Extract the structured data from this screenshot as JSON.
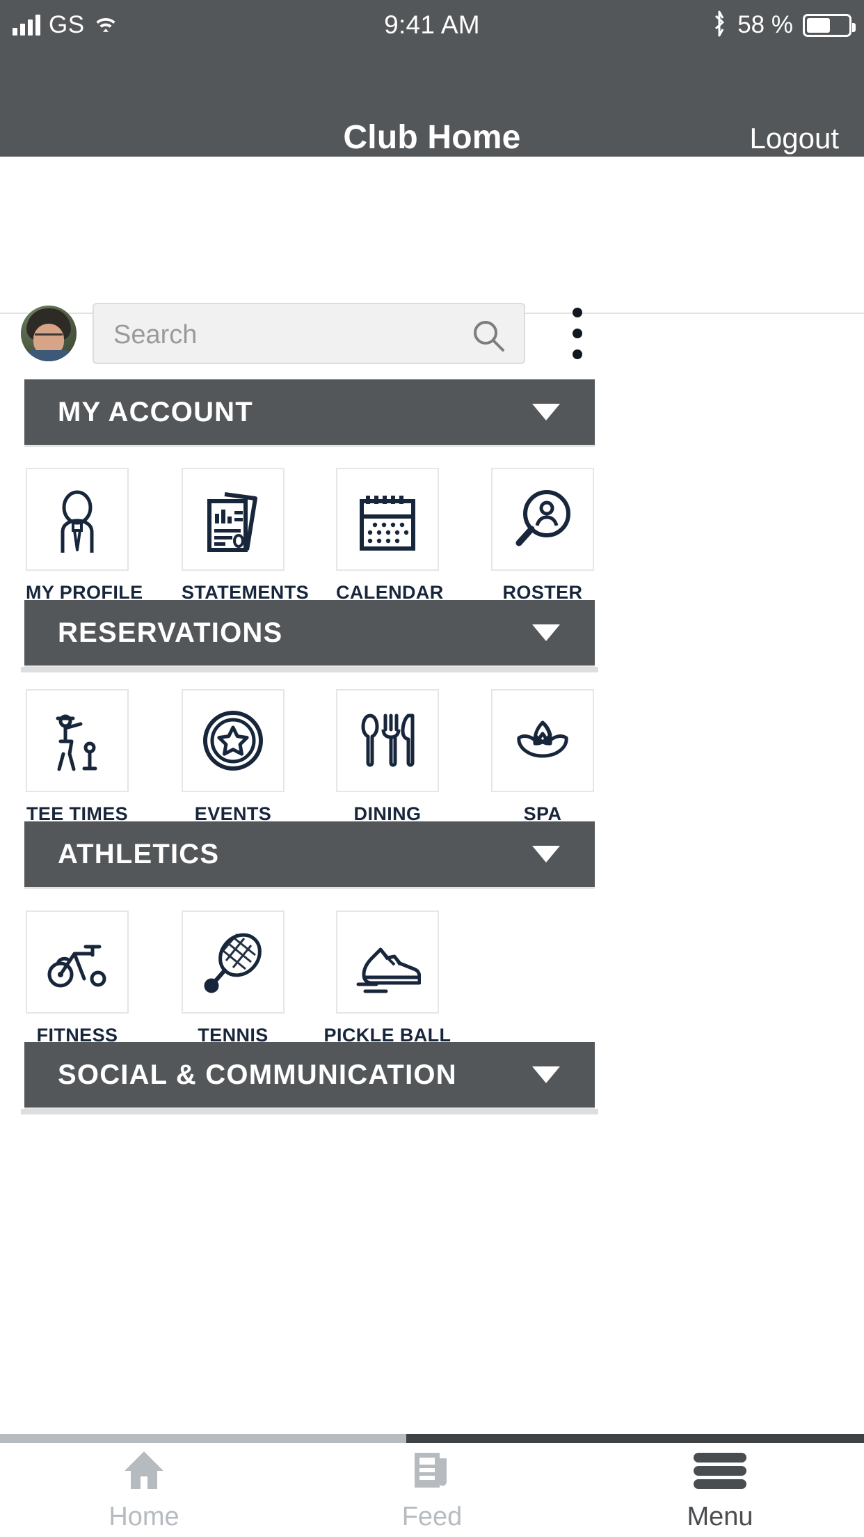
{
  "status_bar": {
    "carrier": "GS",
    "time": "9:41 AM",
    "battery_percent": "58 %",
    "signal_icon": "cellular-signal-icon",
    "wifi_icon": "wifi-icon",
    "bluetooth_icon": "bluetooth-icon",
    "battery_icon": "battery-icon",
    "battery_level": 58
  },
  "nav_bar": {
    "title": "Club Home",
    "logout_label": "Logout",
    "background_color": "#545759"
  },
  "search": {
    "placeholder": "Search",
    "value": "",
    "search_icon": "search-icon",
    "avatar": "user-avatar",
    "overflow_icon": "kebab-menu-icon"
  },
  "sections": [
    {
      "title": "MY ACCOUNT",
      "caret": "chevron-down-icon",
      "tiles": [
        {
          "label": "MY PROFILE",
          "icon": "person-tie-icon"
        },
        {
          "label": "STATEMENTS",
          "icon": "documents-report-icon"
        },
        {
          "label": "CALENDAR",
          "icon": "calendar-icon"
        },
        {
          "label": "ROSTER",
          "icon": "person-search-icon"
        }
      ]
    },
    {
      "title": "RESERVATIONS",
      "caret": "chevron-down-icon",
      "tiles": [
        {
          "label": "TEE TIMES",
          "icon": "golfer-icon"
        },
        {
          "label": "EVENTS",
          "icon": "star-badge-icon"
        },
        {
          "label": "DINING",
          "icon": "cutlery-icon"
        },
        {
          "label": "SPA",
          "icon": "lotus-icon"
        }
      ]
    },
    {
      "title": "ATHLETICS",
      "caret": "chevron-down-icon",
      "tiles": [
        {
          "label": "FITNESS",
          "icon": "exercise-bike-icon"
        },
        {
          "label": "TENNIS",
          "icon": "tennis-racket-icon"
        },
        {
          "label": "PICKLE BALL",
          "icon": "running-shoe-icon"
        }
      ]
    },
    {
      "title": "SOCIAL & COMMUNICATION",
      "caret": "chevron-down-icon",
      "tiles": []
    }
  ],
  "tab_bar": [
    {
      "label": "Home",
      "icon": "home-icon",
      "active": false
    },
    {
      "label": "Feed",
      "icon": "newspaper-icon",
      "active": false
    },
    {
      "label": "Menu",
      "icon": "hamburger-menu-icon",
      "active": true
    }
  ],
  "colors": {
    "header_gray": "#545759",
    "icon_navy": "#18263b",
    "tab_inactive": "#b6bbc0",
    "tab_active": "#4a4d4f",
    "search_field": "#f1f1f1"
  }
}
